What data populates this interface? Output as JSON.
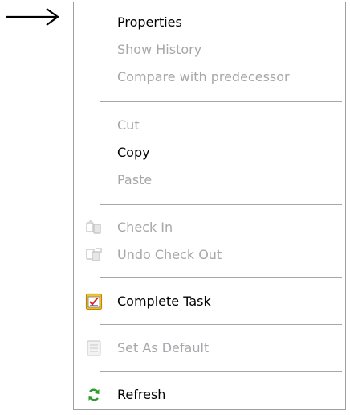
{
  "menu": {
    "items": [
      {
        "label": "Properties",
        "enabled": true
      },
      {
        "label": "Show History",
        "enabled": false
      },
      {
        "label": "Compare with predecessor",
        "enabled": false
      },
      {
        "label": "Cut",
        "enabled": false
      },
      {
        "label": "Copy",
        "enabled": true
      },
      {
        "label": "Paste",
        "enabled": false
      },
      {
        "label": "Check In",
        "enabled": false,
        "icon": "check-in-icon"
      },
      {
        "label": "Undo Check Out",
        "enabled": false,
        "icon": "undo-check-out-icon"
      },
      {
        "label": "Complete Task",
        "enabled": true,
        "icon": "complete-task-icon"
      },
      {
        "label": "Set As Default",
        "enabled": false,
        "icon": "set-as-default-icon"
      },
      {
        "label": "Refresh",
        "enabled": true,
        "icon": "refresh-icon"
      }
    ]
  },
  "colors": {
    "enabled_text": "#000000",
    "disabled_text": "#a7a6aa",
    "separator": "#a7a7a7",
    "menu_border": "#a0a0a0"
  },
  "pointer_icon": "right-arrow-icon"
}
